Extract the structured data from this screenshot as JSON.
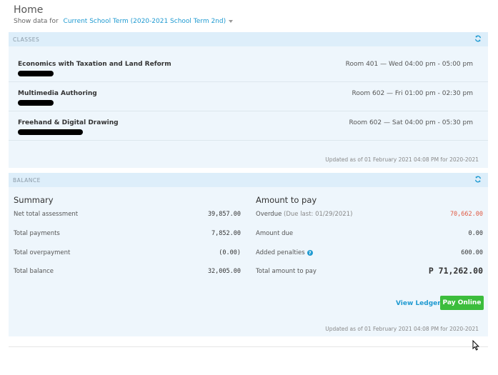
{
  "header": {
    "title": "Home",
    "show_data_label": "Show data for",
    "term": "Current School Term (2020-2021 School Term 2nd)"
  },
  "classes_panel": {
    "label": "CLASSES",
    "items": [
      {
        "name": "Economics with Taxation and Land Reform",
        "schedule": "Room 401 — Wed 04:00 pm - 05:00 pm"
      },
      {
        "name": "Multimedia Authoring",
        "schedule": "Room 602 — Fri 01:00 pm - 02:30 pm"
      },
      {
        "name": "Freehand & Digital Drawing",
        "schedule": "Room 602 — Sat 04:00 pm - 05:30 pm"
      }
    ],
    "updated": "Updated as of 01 February 2021 04:08 PM for 2020-2021"
  },
  "balance_panel": {
    "label": "BALANCE",
    "summary": {
      "title": "Summary",
      "rows": [
        {
          "label": "Net total assessment",
          "value": "39,857.00"
        },
        {
          "label": "Total payments",
          "value": "7,852.00"
        },
        {
          "label": "Total overpayment",
          "value": "(0.00)"
        },
        {
          "label": "Total balance",
          "value": "32,005.00"
        }
      ]
    },
    "amount_to_pay": {
      "title": "Amount to pay",
      "overdue_label": "Overdue",
      "overdue_sub": "(Due last: 01/29/2021)",
      "overdue_value": "70,662.00",
      "amount_due_label": "Amount due",
      "amount_due_value": "0.00",
      "penalties_label": "Added penalties",
      "penalties_value": "600.00",
      "total_label": "Total amount to pay",
      "total_value": "P 71,262.00"
    },
    "view_ledger": "View Ledger",
    "pay_online": "Pay Online",
    "updated": "Updated as of 01 February 2021 04:08 PM for 2020-2021"
  },
  "colors": {
    "accent": "#1f9ad1",
    "panel_bg": "#eef6fc",
    "panel_head_bg": "#ddeefa",
    "overdue": "#e05a43",
    "pay_button": "#3cbd3c"
  }
}
